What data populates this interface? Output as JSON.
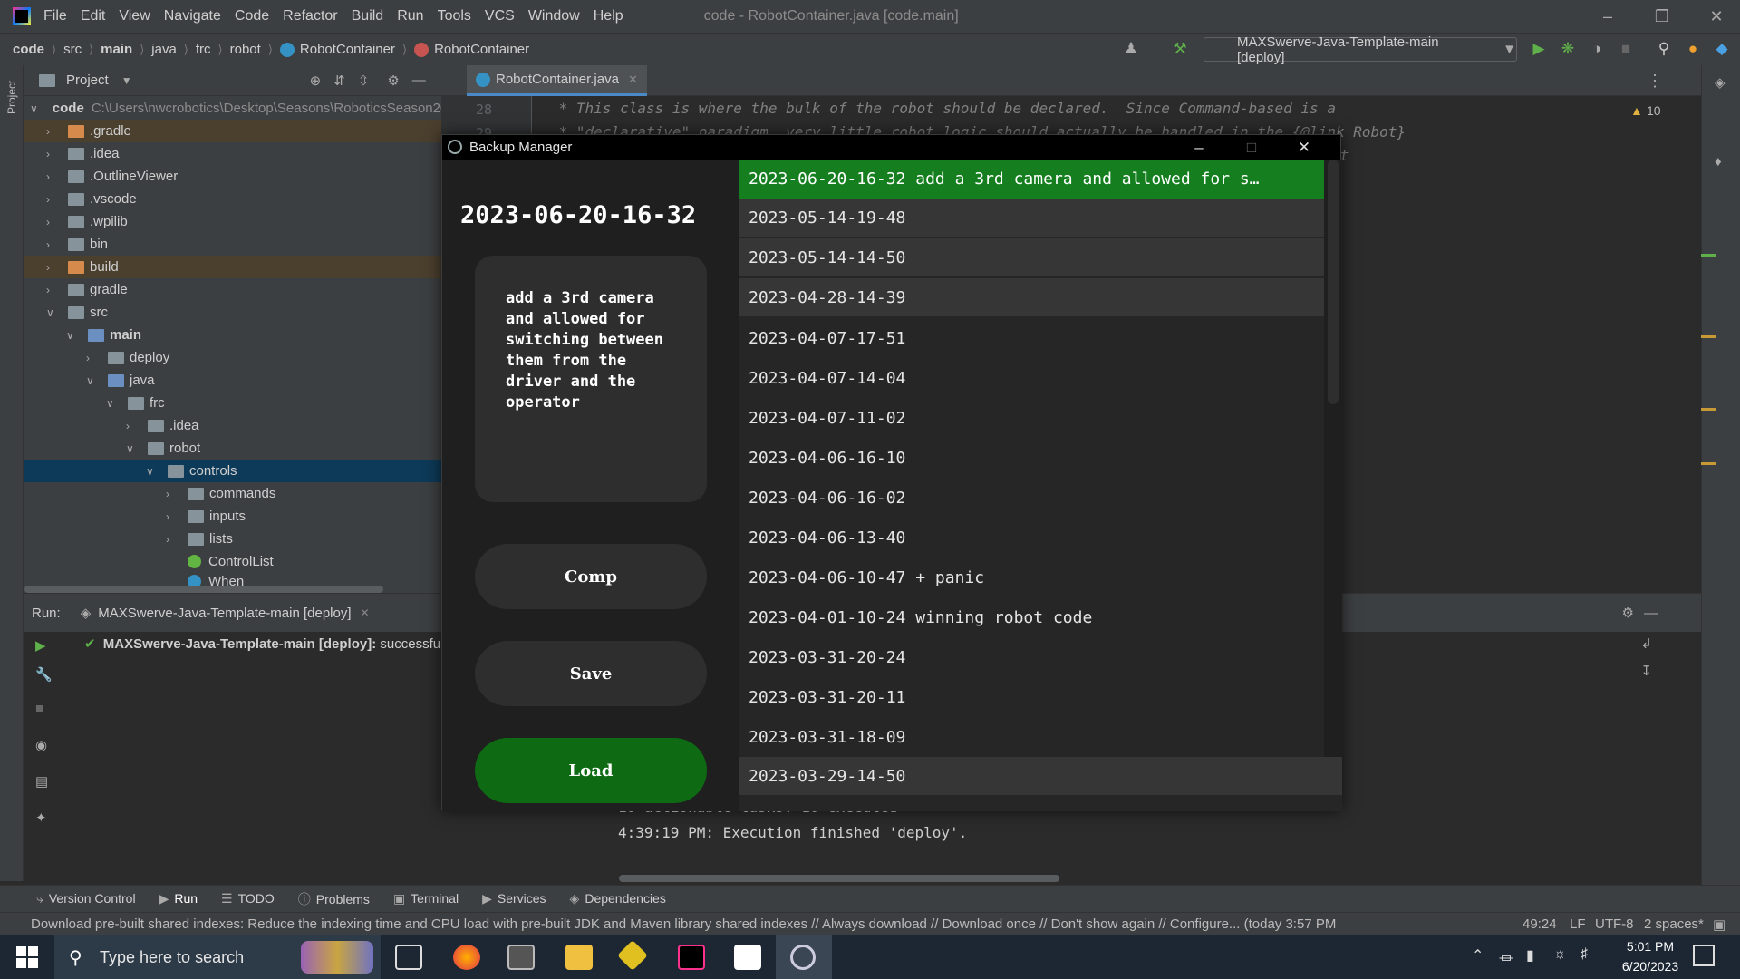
{
  "menubar": {
    "items": [
      "File",
      "Edit",
      "View",
      "Navigate",
      "Code",
      "Refactor",
      "Build",
      "Run",
      "Tools",
      "VCS",
      "Window",
      "Help"
    ],
    "title": "code - RobotContainer.java [code.main]"
  },
  "navbar": {
    "crumbs": [
      "code",
      "src",
      "main",
      "java",
      "frc",
      "robot",
      "RobotContainer",
      "RobotContainer"
    ],
    "run_config": "MAXSwerve-Java-Template-main [deploy]"
  },
  "project": {
    "title": "Project",
    "root_name": "code",
    "root_path": "C:\\Users\\nwcrobotics\\Desktop\\Seasons\\RoboticsSeason20",
    "tree": [
      ".gradle",
      ".idea",
      ".OutlineViewer",
      ".vscode",
      ".wpilib",
      "bin",
      "build",
      "gradle",
      "src",
      "main",
      "deploy",
      "java",
      "frc",
      ".idea",
      "robot",
      "controls",
      "commands",
      "inputs",
      "lists",
      "ControlList",
      "When"
    ]
  },
  "editor": {
    "tab": "RobotContainer.java",
    "line_numbers": [
      "28",
      "29"
    ],
    "lines": [
      " * This class is where the bulk of the robot should be declared.  Since Command-based is a",
      " * \"declarative\" paradigm, very little robot logic should actually be handled in the {@link Robot}",
      "ot"
    ],
    "warnings": "10"
  },
  "run_panel": {
    "label": "Run:",
    "tab": "MAXSwerve-Java-Template-main [deploy]",
    "entry_title": "MAXSwerve-Java-Template-main [deploy]:",
    "entry_status": "successfu",
    "console": [
      "10 actionable tasks: 10 executed",
      "4:39:19 PM: Execution finished 'deploy'."
    ]
  },
  "bottom_tabs": [
    "Version Control",
    "Run",
    "TODO",
    "Problems",
    "Terminal",
    "Services",
    "Dependencies"
  ],
  "status": {
    "message": "Download pre-built shared indexes: Reduce the indexing time and CPU load with pre-built JDK and Maven library shared indexes // Always download // Download once // Don't show again // Configure... (today 3:57 PM)",
    "position": "49:24",
    "line_sep": "LF",
    "encoding": "UTF-8",
    "indent": "2 spaces*"
  },
  "taskbar": {
    "search_placeholder": "Type here to search",
    "time": "5:01 PM",
    "date": "6/20/2023"
  },
  "backup_manager": {
    "title": "Backup Manager",
    "selected_date": "2023-06-20-16-32",
    "description": "add a 3rd camera and allowed for switching between them from the driver and the operator",
    "buttons": {
      "comp": "Comp",
      "save": "Save",
      "load": "Load"
    },
    "entries": [
      "2023-06-20-16-32 add a 3rd camera and allowed for s…",
      "2023-05-14-19-48",
      "2023-05-14-14-50",
      "2023-04-28-14-39",
      "2023-04-07-17-51",
      "2023-04-07-14-04",
      "2023-04-07-11-02",
      "2023-04-06-16-10",
      "2023-04-06-16-02",
      "2023-04-06-13-40",
      "2023-04-06-10-47 + panic",
      "2023-04-01-10-24 winning robot code",
      "2023-03-31-20-24",
      "2023-03-31-20-11",
      "2023-03-31-18-09",
      "2023-03-29-14-50"
    ],
    "colors": {
      "accent": "#157f1f",
      "load": "#0e6b14",
      "bg": "#1f1f1f"
    }
  }
}
